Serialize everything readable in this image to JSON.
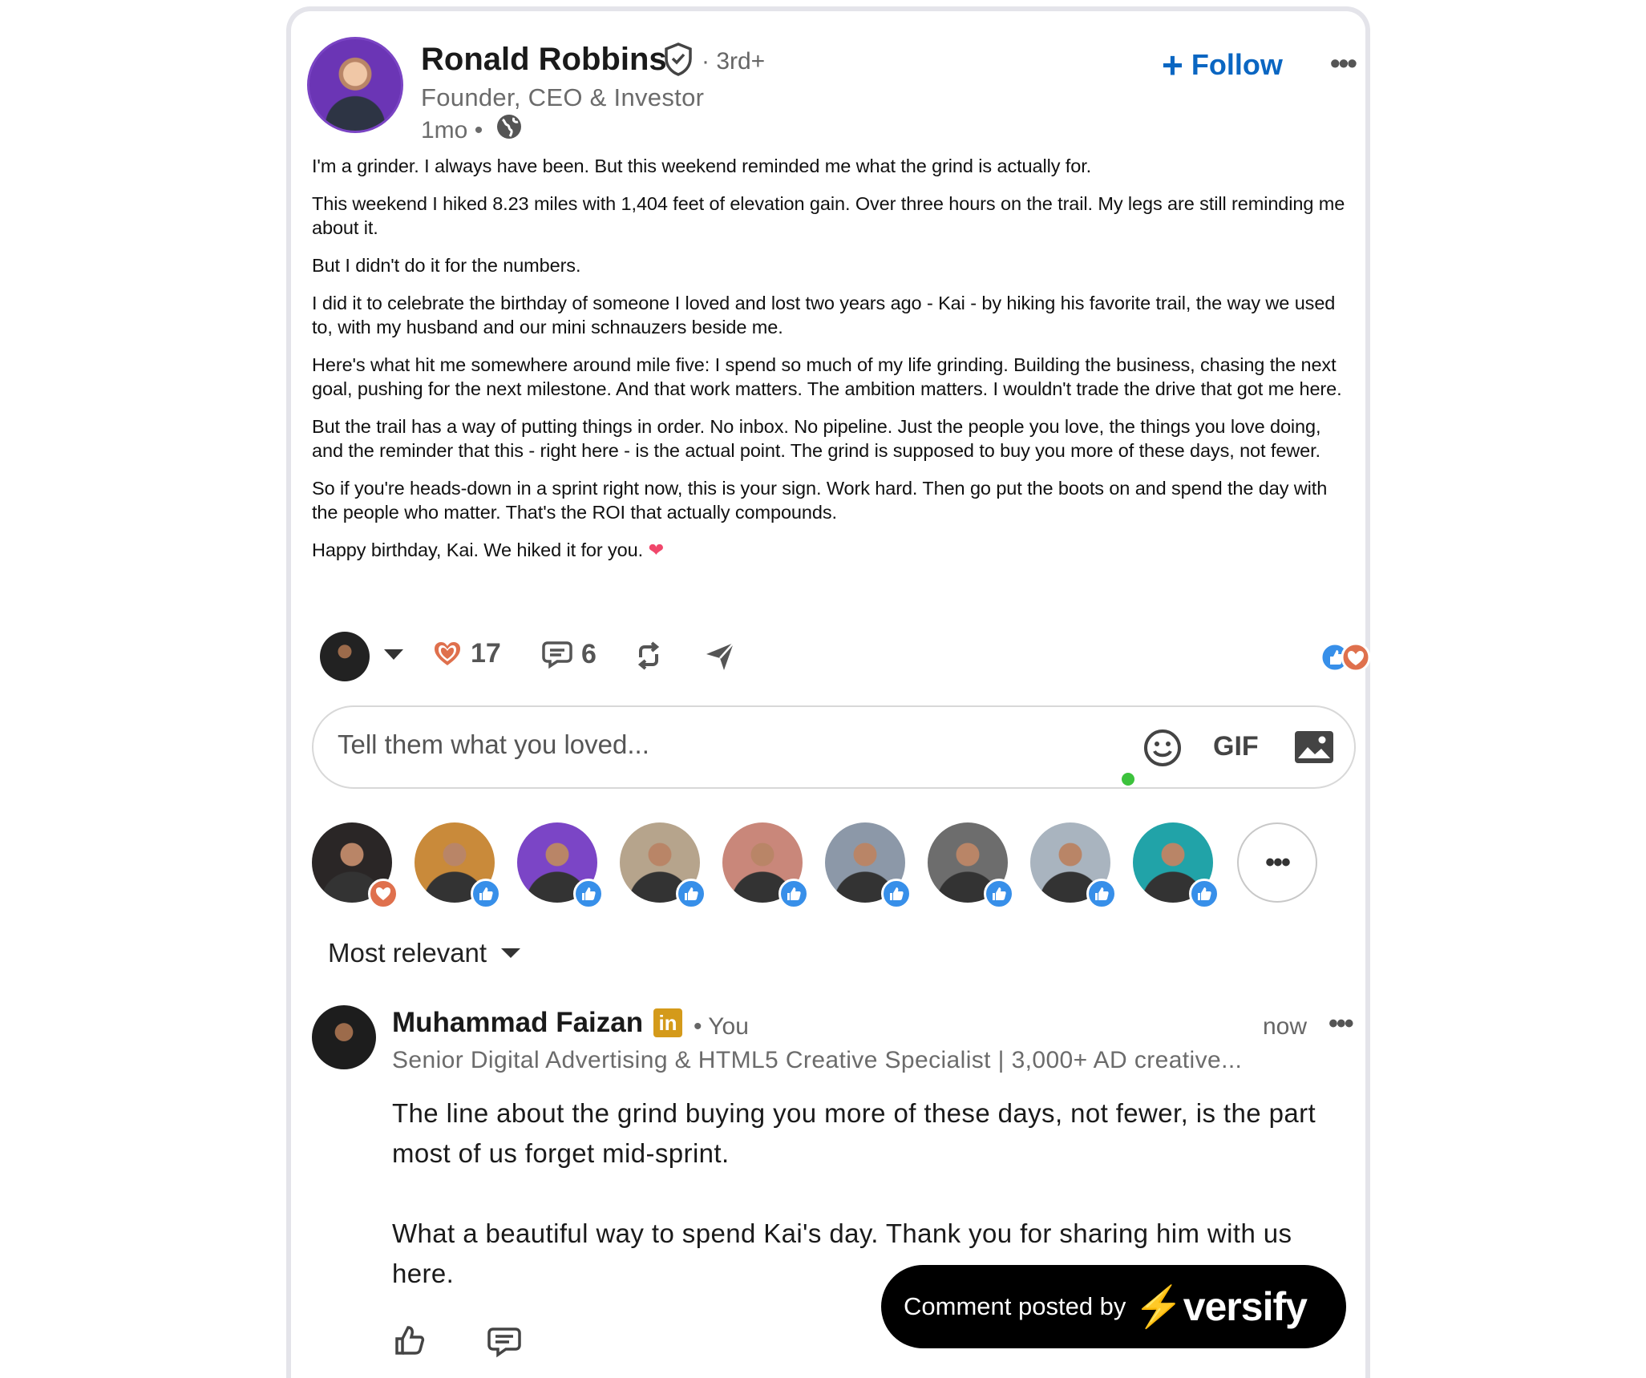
{
  "post": {
    "author_name": "Ronald Robbins",
    "degree": "· 3rd+",
    "headline": "Founder, CEO & Investor",
    "time": "1mo •",
    "follow_label": "Follow",
    "paragraphs": [
      "I'm a grinder. I always have been. But this weekend reminded me what the grind is actually for.",
      "This weekend I hiked 8.23 miles with 1,404 feet of elevation gain. Over three hours on the trail. My legs are still reminding me about it.",
      "But I didn't do it for the numbers.",
      "I did it to celebrate the birthday of someone I loved and lost two years ago - Kai - by hiking his favorite trail, the way we used to, with my husband and our mini schnauzers beside me.",
      "Here's what hit me somewhere around mile five: I spend so much of my life grinding. Building the business, chasing the next goal, pushing for the next milestone. And that work matters. The ambition matters. I wouldn't trade the drive that got me here.",
      "But the trail has a way of putting things in order. No inbox. No pipeline. Just the people you love, the things you love doing, and the reminder that this - right here - is the actual point. The grind is supposed to buy you more of these days, not fewer.",
      "So if you're heads-down in a sprint right now, this is your sign. Work hard. Then go put the boots on and spend the day with the people who matter. That's the ROI that actually compounds."
    ],
    "closing": "Happy birthday, Kai. We hiked it for you."
  },
  "actions": {
    "reaction_count": "17",
    "comment_count": "6"
  },
  "comment_input": {
    "placeholder": "Tell them what you loved...",
    "gif_label": "GIF"
  },
  "reactors": {
    "items": [
      {
        "reaction": "love",
        "color": "#2a2626"
      },
      {
        "reaction": "like",
        "color": "#c98a3a"
      },
      {
        "reaction": "like",
        "color": "#7b45c6"
      },
      {
        "reaction": "like",
        "color": "#b6a48c"
      },
      {
        "reaction": "like",
        "color": "#c9877a"
      },
      {
        "reaction": "like",
        "color": "#8c98a8"
      },
      {
        "reaction": "like",
        "color": "#6d6d6d"
      },
      {
        "reaction": "like",
        "color": "#a9b4bf"
      },
      {
        "reaction": "like",
        "color": "#21a3a8"
      }
    ],
    "more_label": "•••"
  },
  "sort": {
    "label": "Most relevant"
  },
  "comment": {
    "author_name": "Muhammad Faizan",
    "badge": "in",
    "relation": "• You",
    "time": "now",
    "headline": "Senior Digital Advertising & HTML5 Creative Specialist | 3,000+ AD creative...",
    "paragraphs": [
      "The line about the grind buying you more of these days, not fewer, is the part most of us forget mid-sprint.",
      "What a beautiful way to spend Kai's day. Thank you for sharing him with us here."
    ]
  },
  "overlay": {
    "label": "Comment posted by",
    "brand": "versify"
  },
  "colors": {
    "accent": "#0a66c2",
    "like": "#378fe9",
    "love": "#df704d",
    "online": "#3cc23c"
  }
}
